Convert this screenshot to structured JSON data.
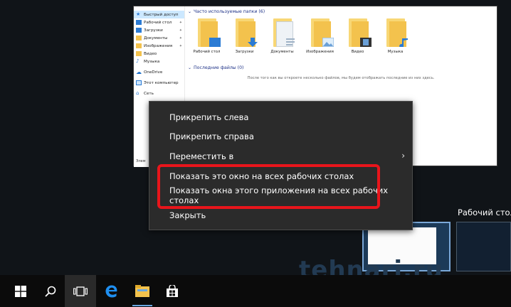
{
  "explorer": {
    "nav_items": [
      {
        "label": "Быстрый доступ",
        "icon": "star-icon",
        "pinned": false
      },
      {
        "label": "Рабочий стол",
        "icon": "desktop-folder-icon",
        "pinned": true
      },
      {
        "label": "Загрузки",
        "icon": "downloads-folder-icon",
        "pinned": true
      },
      {
        "label": "Документы",
        "icon": "documents-folder-icon",
        "pinned": true
      },
      {
        "label": "Изображения",
        "icon": "pictures-folder-icon",
        "pinned": true
      },
      {
        "label": "Видео",
        "icon": "video-folder-icon",
        "pinned": false
      },
      {
        "label": "Музыка",
        "icon": "music-folder-icon",
        "pinned": false
      },
      {
        "label": "OneDrive",
        "icon": "cloud-icon",
        "pinned": false
      },
      {
        "label": "Этот компьютер",
        "icon": "computer-icon",
        "pinned": false
      },
      {
        "label": "Сеть",
        "icon": "network-icon",
        "pinned": false
      }
    ],
    "frequent_title": "Часто используемые папки (6)",
    "folders": [
      {
        "label": "Рабочий стол",
        "icon": "desktop-folder-icon",
        "badge": "#2b7bd4"
      },
      {
        "label": "Загрузки",
        "icon": "downloads-folder-icon",
        "badge": "#2b7bd4"
      },
      {
        "label": "Документы",
        "icon": "documents-folder-icon",
        "badge": "#e8eef5"
      },
      {
        "label": "Изображения",
        "icon": "pictures-folder-icon",
        "badge": "#6aa0d8"
      },
      {
        "label": "Видео",
        "icon": "video-folder-icon",
        "badge": "#333333"
      },
      {
        "label": "Музыка",
        "icon": "music-folder-icon",
        "badge": "#2b7bd4"
      }
    ],
    "recent_title": "Последние файлы (0)",
    "recent_empty": "После того как вы откроете несколько файлов, мы будем отображать последние из них здесь.",
    "status": "Элем"
  },
  "menu": {
    "items": [
      {
        "label": "Прикрепить слева",
        "submenu": false
      },
      {
        "label": "Прикрепить справа",
        "submenu": false
      },
      {
        "label": "Переместить в",
        "submenu": true
      },
      {
        "label": "Показать это окно на всех рабочих столах",
        "submenu": false
      },
      {
        "label": "Показать окна этого приложения на всех рабочих столах",
        "submenu": false
      },
      {
        "label": "Закрыть",
        "submenu": false
      }
    ],
    "highlight_color": "#e8151b"
  },
  "desktops": {
    "desktop_label": "Рабочий стол"
  },
  "watermark": "tehnari.ru",
  "taskbar": {
    "buttons": [
      "windows-start-icon",
      "search-icon",
      "task-view-icon",
      "edge-icon",
      "file-explorer-icon",
      "store-icon"
    ]
  }
}
